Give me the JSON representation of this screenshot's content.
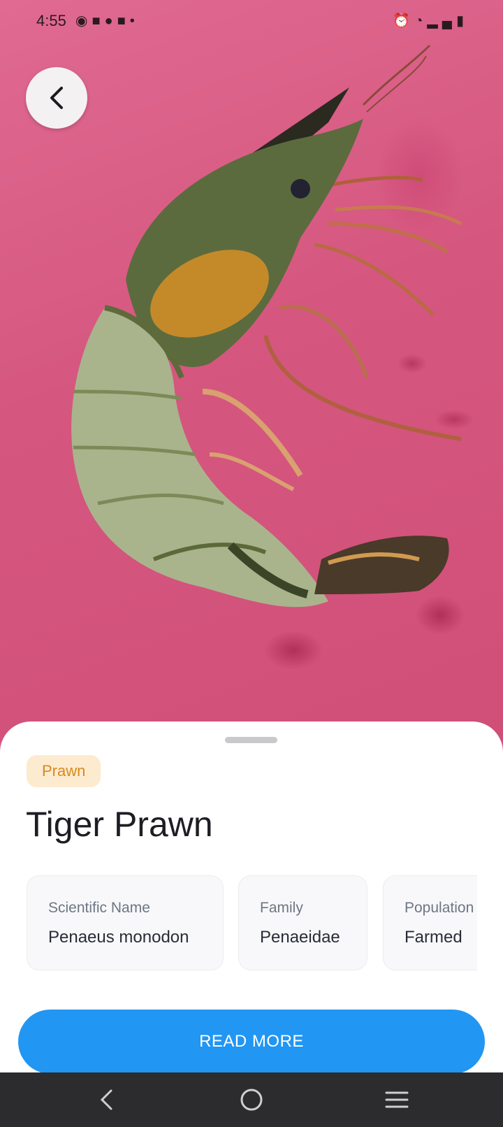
{
  "status_bar": {
    "time": "4:55",
    "left_icons": [
      "messenger-icon",
      "facebook-icon",
      "chat-icon",
      "facebook-icon",
      "dot-icon"
    ],
    "right_icons": [
      "alarm-icon",
      "wifi-icon",
      "signal-icon",
      "battery-icon"
    ]
  },
  "header": {
    "back_icon": "chevron-left-icon"
  },
  "species": {
    "tag": "Prawn",
    "title": "Tiger Prawn",
    "info_cards": [
      {
        "label": "Scientific Name",
        "value": "Penaeus monodon"
      },
      {
        "label": "Family",
        "value": "Penaeidae"
      },
      {
        "label": "Population",
        "value": "Farmed"
      }
    ]
  },
  "actions": {
    "read_more": "READ MORE"
  },
  "system_nav": [
    "back-icon",
    "home-icon",
    "recents-icon"
  ],
  "colors": {
    "accent": "#2196f3",
    "tag_bg": "#fdebd0",
    "tag_text": "#d88a1c"
  }
}
